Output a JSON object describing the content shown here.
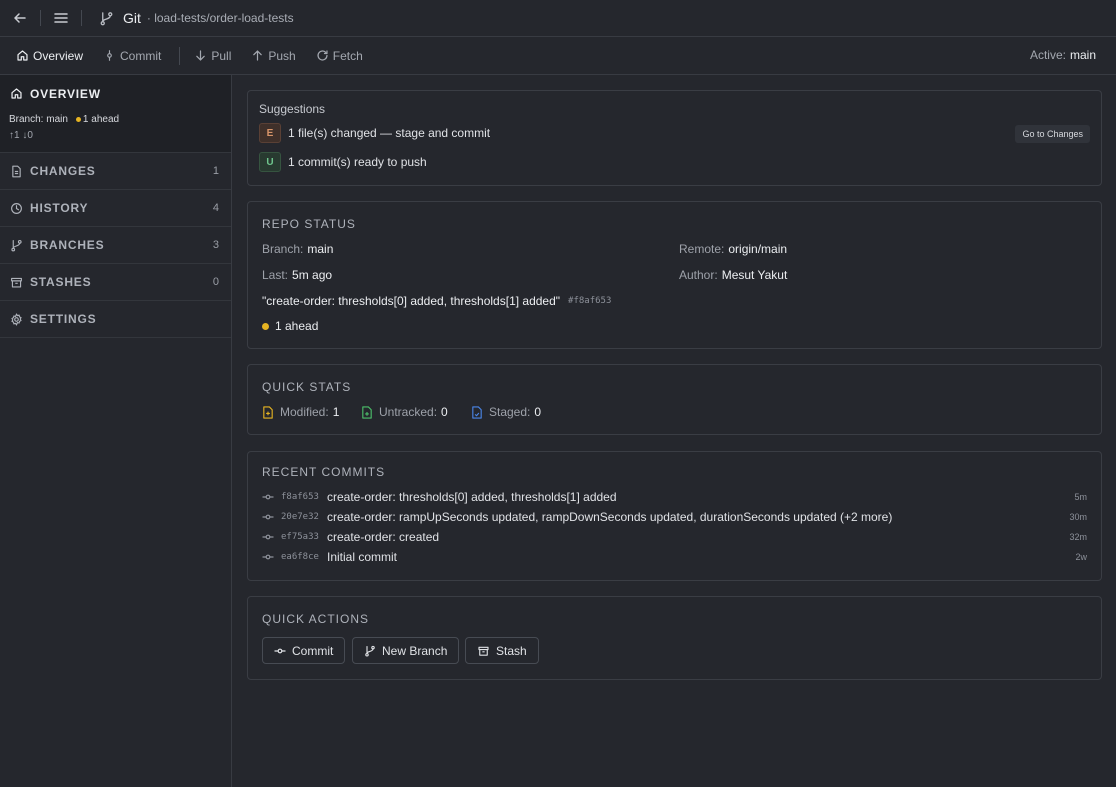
{
  "topbar": {
    "title": "Git",
    "path": "· load-tests/order-load-tests"
  },
  "toolbar": {
    "overview": "Overview",
    "commit": "Commit",
    "pull": "Pull",
    "push": "Push",
    "fetch": "Fetch",
    "active_label": "Active:",
    "active_branch": "main"
  },
  "sidebar": {
    "overview": {
      "label": "OVERVIEW",
      "branch_text": "Branch: main",
      "ahead_text": "1 ahead",
      "sync_text": "↑1 ↓0"
    },
    "items": [
      {
        "label": "CHANGES",
        "count": "1",
        "icon": "file-icon"
      },
      {
        "label": "HISTORY",
        "count": "4",
        "icon": "clock-icon"
      },
      {
        "label": "BRANCHES",
        "count": "3",
        "icon": "branch-icon"
      },
      {
        "label": "STASHES",
        "count": "0",
        "icon": "archive-icon"
      },
      {
        "label": "SETTINGS",
        "count": "",
        "icon": "gear-icon"
      }
    ]
  },
  "suggestions": {
    "title": "Suggestions",
    "items": [
      {
        "badge": "E",
        "text": "1 file(s) changed — stage and commit",
        "action": "Go to Changes"
      },
      {
        "badge": "U",
        "text": "1 commit(s) ready to push"
      }
    ]
  },
  "repo_status": {
    "title": "REPO STATUS",
    "branch_label": "Branch:",
    "branch": "main",
    "remote_label": "Remote:",
    "remote": "origin/main",
    "last_label": "Last:",
    "last": "5m ago",
    "author_label": "Author:",
    "author": "Mesut Yakut",
    "last_message": "\"create-order: thresholds[0] added, thresholds[1] added\"",
    "last_hash": "#f8af653",
    "ahead": "1 ahead"
  },
  "quick_stats": {
    "title": "QUICK STATS",
    "modified_label": "Modified:",
    "modified": "1",
    "untracked_label": "Untracked:",
    "untracked": "0",
    "staged_label": "Staged:",
    "staged": "0"
  },
  "recent_commits": {
    "title": "RECENT COMMITS",
    "items": [
      {
        "hash": "f8af653",
        "message": "create-order: thresholds[0] added, thresholds[1] added",
        "age": "5m"
      },
      {
        "hash": "20e7e32",
        "message": "create-order: rampUpSeconds updated, rampDownSeconds updated, durationSeconds updated (+2 more)",
        "age": "30m"
      },
      {
        "hash": "ef75a33",
        "message": "create-order: created",
        "age": "32m"
      },
      {
        "hash": "ea6f8ce",
        "message": "Initial commit",
        "age": "2w"
      }
    ]
  },
  "quick_actions": {
    "title": "QUICK ACTIONS",
    "commit": "Commit",
    "new_branch": "New Branch",
    "stash": "Stash"
  },
  "colors": {
    "background": "#25272d",
    "ahead_dot": "#e6b422",
    "modified": "#e6b422",
    "untracked": "#4cbf6a",
    "staged": "#4a86e8"
  }
}
